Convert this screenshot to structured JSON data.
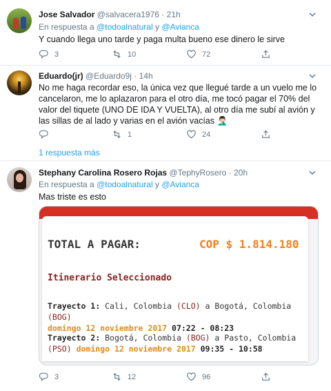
{
  "tweets": [
    {
      "name": "Jose Salvador",
      "handle": "@salvacera1976",
      "dot": "·",
      "time": "21h",
      "reply_prefix": "En respuesta a",
      "reply_to_1": "@todoalnatural",
      "reply_and": "y",
      "reply_to_2": "@Avianca",
      "text": "Y cuando llega uno tarde y paga multa bueno ese dinero le sirve",
      "replies": "3",
      "retweets": "10",
      "likes": "72"
    },
    {
      "name": "Eduardo(jr)",
      "handle": "@Eduardo9j",
      "dot": "·",
      "time": "14h",
      "text": "No me haga recordar eso, la única vez que llegué tarde a un vuelo me lo cancelaron, me lo aplazaron para el otro día, me tocó pagar el 70% del valor del tiquete (UNO DE IDA Y VUELTA), al otro día me subí al avión y las sillas de al lado y varias en el avión vacías 🤦🏻‍♂️",
      "replies": "",
      "retweets": "1",
      "likes": "24",
      "more_replies": "1 respuesta más"
    },
    {
      "name": "Stephany Carolina Rosero Rojas",
      "handle": "@TephyRosero",
      "dot": "·",
      "time": "20h",
      "reply_prefix": "En respuesta a",
      "reply_to_1": "@todoalnatural",
      "reply_and": "y",
      "reply_to_2": "@Avianca",
      "text": "Mas triste es esto",
      "replies": "3",
      "retweets": "12",
      "likes": "96"
    }
  ],
  "card": {
    "total_label": "TOTAL A PAGAR:",
    "total_amount": "COP $ 1.814.180",
    "itinerary_title": "Itinerario Seleccionado",
    "legs": [
      {
        "label": "Trayecto 1:",
        "from": "Cali, Colombia",
        "from_code": "(CLO)",
        "connector": "a",
        "to": "Bogotá, Colombia",
        "to_code": "(BOG)",
        "date": "domingo 12 noviembre 2017",
        "hours": "07:22 - 08:23"
      },
      {
        "label": "Trayecto 2:",
        "from": "Bogotá, Colombia",
        "from_code": "(BOG)",
        "connector": "a",
        "to": "Pasto, Colombia",
        "to_code": "(PSO)",
        "date": "domingo 12 noviembre 2017",
        "hours": "09:35 - 10:58"
      }
    ]
  },
  "icons": {
    "reply": "reply-icon",
    "retweet": "retweet-icon",
    "like": "heart-icon",
    "share": "share-icon",
    "caret": "chevron-down-icon"
  },
  "colors": {
    "link": "#1da1f2",
    "muted": "#657786",
    "card_red": "#d62f23",
    "amount_orange": "#f57f17",
    "title_dark_red": "#8b1e1e"
  }
}
